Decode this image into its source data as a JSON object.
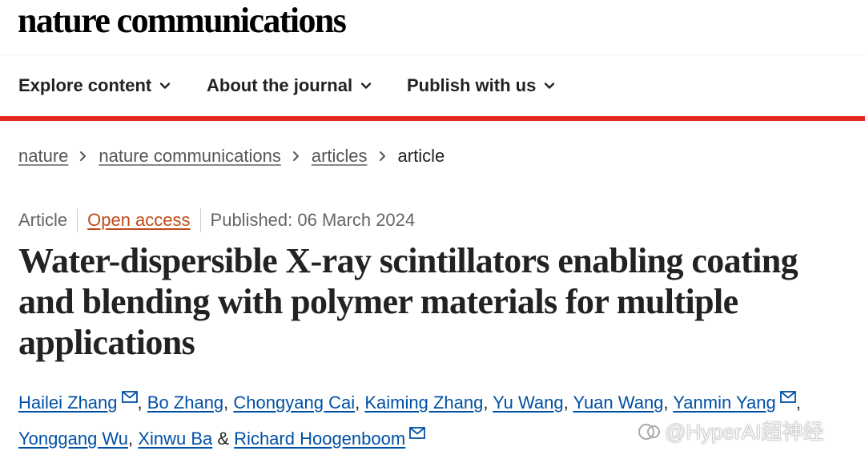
{
  "header": {
    "logo": "nature communications"
  },
  "nav": {
    "items": [
      "Explore content",
      "About the journal",
      "Publish with us"
    ]
  },
  "breadcrumb": {
    "items": [
      "nature",
      "nature communications",
      "articles"
    ],
    "current": "article"
  },
  "meta": {
    "type": "Article",
    "access": "Open access",
    "published": "Published: 06 March 2024"
  },
  "article": {
    "title": "Water-dispersible X-ray scintillators enabling coating and blending with polymer materials for multiple applications",
    "authors": [
      {
        "name": "Hailei Zhang",
        "mail": true
      },
      {
        "name": "Bo Zhang",
        "mail": false
      },
      {
        "name": "Chongyang Cai",
        "mail": false
      },
      {
        "name": "Kaiming Zhang",
        "mail": false
      },
      {
        "name": "Yu Wang",
        "mail": false
      },
      {
        "name": "Yuan Wang",
        "mail": false
      },
      {
        "name": "Yanmin Yang",
        "mail": true
      },
      {
        "name": "Yonggang Wu",
        "mail": false
      },
      {
        "name": "Xinwu Ba",
        "mail": false
      },
      {
        "name": "Richard Hoogenboom",
        "mail": true
      }
    ],
    "sep_comma": ",",
    "sep_and": "&"
  },
  "watermark": {
    "text": "@HyperAI超神经"
  },
  "colors": {
    "accent_bar": "#e8281e",
    "link": "#0050a6",
    "open_access": "#c04a1a"
  },
  "icons": {
    "nav_dropdown": "chevron-down-icon",
    "breadcrumb_separator": "chevron-right-icon",
    "author_contact": "mail-icon"
  }
}
